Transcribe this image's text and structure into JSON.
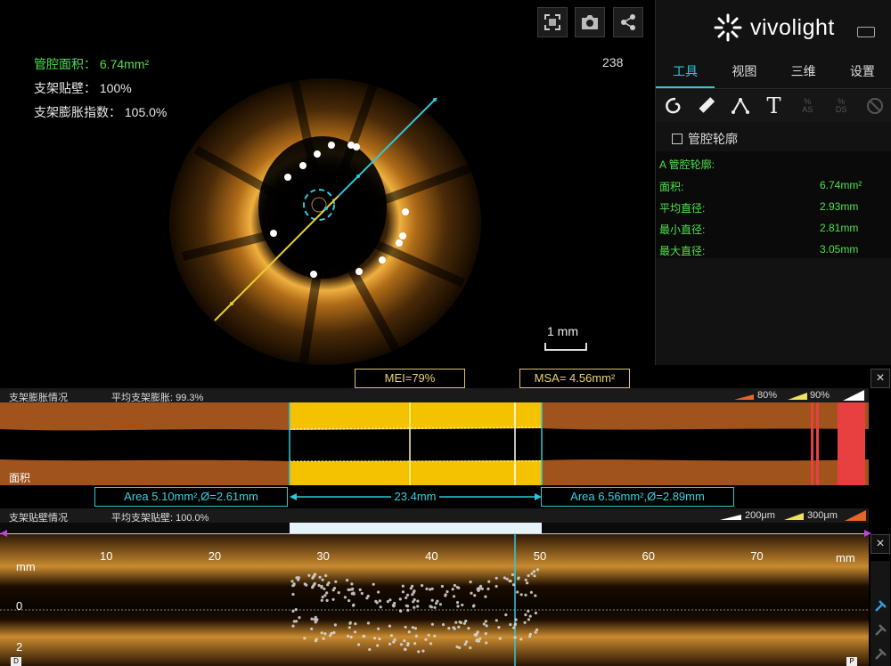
{
  "viewer": {
    "lumen_area_label": "管腔面积：",
    "lumen_area_value": "6.74mm²",
    "apposition_label": "支架贴壁：",
    "apposition_value": "100%",
    "expansion_label": "支架膨胀指数：",
    "expansion_value": "105.0%",
    "frame_number": "238",
    "scale_label": "1 mm",
    "toolbar": [
      "fullscreen-icon",
      "camera-icon",
      "share-icon"
    ]
  },
  "panel": {
    "logo": "vivolight",
    "tabs": [
      {
        "label": "工具",
        "active": true
      },
      {
        "label": "视图",
        "active": false
      },
      {
        "label": "三维",
        "active": false
      },
      {
        "label": "设置",
        "active": false
      }
    ],
    "tools": [
      "lumen-contour-tool-icon",
      "ruler-tool-icon",
      "angle-tool-icon",
      "text-tool-icon",
      "as-tool-icon",
      "ds-tool-icon",
      "erase-tool-icon"
    ],
    "tool_sub_labels": {
      "as": "AS",
      "ds": "DS",
      "pct": "%",
      "text": "T"
    },
    "lumen_contour_checkbox": "管腔轮廓",
    "measurement_title": "A 管腔轮廓:",
    "measurements": [
      {
        "label": "面积:",
        "value": "6.74mm²"
      },
      {
        "label": "平均直径:",
        "value": "2.93mm"
      },
      {
        "label": "最小直径:",
        "value": "2.81mm"
      },
      {
        "label": "最大直径:",
        "value": "3.05mm"
      }
    ]
  },
  "expansion": {
    "title": "支架膨胀情况",
    "avg_label": "平均支架膨胀: 99.3%",
    "legend_80": "80%",
    "legend_90": "90%",
    "mei": "MEI=79%",
    "msa": "MSA= 4.56mm²",
    "area_label": "面积",
    "area_left": "Area 5.10mm²,Ø=2.61mm",
    "area_right": "Area 6.56mm²,Ø=2.89mm",
    "length": "23.4mm",
    "close": "×"
  },
  "apposition": {
    "title": "支架贴壁情况",
    "avg_label": "平均支架贴壁: 100.0%",
    "legend_200": "200μm",
    "legend_300": "300μm"
  },
  "lmode": {
    "unit_left": "mm",
    "unit_right": "mm",
    "ticks": [
      "10",
      "20",
      "30",
      "40",
      "50",
      "60",
      "70"
    ],
    "depth_labels": [
      "0",
      "2"
    ],
    "distal": "D",
    "proximal": "P",
    "close": "×"
  },
  "colors": {
    "accent": "#30c8d8",
    "measure_green": "#4ee04e",
    "stent_yellow": "#f5c200",
    "vessel_brown": "#a0541c"
  }
}
